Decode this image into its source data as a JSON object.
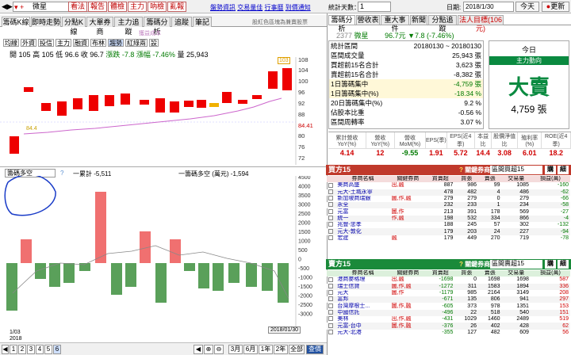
{
  "topbar": {
    "stock": "微星",
    "buttons": [
      "看法",
      "報告",
      "體檢",
      "主力",
      "吶檢",
      "亂報"
    ],
    "links": [
      "盤勢資訊",
      "交易量佳",
      "行事曆",
      "到價通知"
    ],
    "stats_label": "統計天數：",
    "stats_value": "1",
    "date_label": "日期:",
    "date_value": "2018/1/30",
    "today_btn": "今天",
    "update_btn": "更新"
  },
  "tabs": [
    "籌碼K線",
    "即時走勢",
    "分點K線",
    "大單券商",
    "主力追蹤",
    "籌碼分析",
    "追蹤",
    "筆記"
  ],
  "tabs_right_info": "股紅色區塊為兼賣股票",
  "chart_buttons": [
    "均線",
    "外資",
    "投信",
    "主力",
    "融資",
    "布林",
    "趨勢",
    "紅綠兩",
    "設"
  ],
  "ohlc": {
    "open_l": "開",
    "open": "105",
    "high_l": "高",
    "high": "105",
    "low_l": "低",
    "low": "96.6",
    "close_l": "收",
    "close": "96.7",
    "chg_l": "漲跌",
    "chg": "-7.8",
    "pct_l": "漲幅",
    "pct": "-7.46%",
    "vol_l": "量",
    "vol": "25,943"
  },
  "legend_top": "獲益成本",
  "price_axis": [
    "108",
    "104",
    "100",
    "96",
    "92",
    "88",
    "84.41",
    "80",
    "76",
    "72"
  ],
  "ma_value": "84.4",
  "price_tag": "103",
  "lower": {
    "select": "籌碼多空",
    "label1": "一累計",
    "val1": "-5,511",
    "label2": "一籌碼多空 (萬元)",
    "val2": "-1,594"
  },
  "lower_axis": [
    "4500",
    "4000",
    "3500",
    "3000",
    "2500",
    "2000",
    "1500",
    "1000",
    "500",
    "0",
    "-500",
    "-1000",
    "-1500",
    "-2000",
    "-2500",
    "-3000"
  ],
  "date_tag": "2018/01/30",
  "x_start": "1/03",
  "x_year": "2018",
  "bottom_btns": [
    "1",
    "2",
    "3",
    "4",
    "5",
    "6"
  ],
  "period_btns": [
    "3月",
    "6月",
    "1年",
    "2年",
    "全部",
    "查價"
  ],
  "right_tabs": [
    "籌碼分析",
    "營收表",
    "重大事件",
    "新聞",
    "分點追蹤",
    "法人目標(106元)"
  ],
  "quote": {
    "code": "2377",
    "name": "微星",
    "price": "96.7元",
    "chg": "▼7.8 (-7.46%)"
  },
  "stats": [
    [
      "統計區間",
      "20180130 ~ 20180130"
    ],
    [
      "區間成交量",
      "25,943 張"
    ],
    [
      "買超前15名合計",
      "3,623 張"
    ],
    [
      "賣超前15名合計",
      "-8,382 張"
    ],
    [
      "1日籌碼集中",
      "-4,759 張"
    ],
    [
      "1日籌碼集中(%)",
      "-18.34 %"
    ],
    [
      "20日籌碼集中(%)",
      "9.2 %"
    ],
    [
      "佔股本比重",
      "-0.56 %"
    ],
    [
      "區間周轉率",
      "3.07 %"
    ]
  ],
  "today_box": {
    "t1": "今日",
    "t2": "主力動向",
    "big": "大賣",
    "amount": "4,759 張"
  },
  "finance": {
    "headers": [
      "累計營收YoY(%)",
      "營收YoY(%)",
      "營收MoM(%)",
      "EPS(季)",
      "EPS(近4季)",
      "本益比",
      "股價淨值比",
      "殖利率(%)",
      "ROE(近4季)"
    ],
    "values": [
      "4.14",
      "12",
      "-9.55",
      "1.91",
      "5.72",
      "14.4",
      "3.08",
      "6.01",
      "18.2"
    ]
  },
  "buy": {
    "title": "買方15",
    "sel_label": "關鍵券商:",
    "sel": "區間買超15",
    "btn1": "購",
    "btn2": "細",
    "cols": [
      "券商名稱",
      "關鍵券商",
      "買賣超",
      "買張",
      "賣張",
      "交易量",
      "損益(萬)"
    ],
    "rows": [
      [
        "美商高盛",
        "出,融",
        "887",
        "986",
        "99",
        "1085",
        "-160"
      ],
      [
        "元大-土城永寧",
        "",
        "478",
        "482",
        "4",
        "486",
        "-62"
      ],
      [
        "新加坡商瑞銀",
        "圖,作,融",
        "279",
        "279",
        "0",
        "279",
        "-66"
      ],
      [
        "永全",
        "",
        "232",
        "233",
        "1",
        "234",
        "-58"
      ],
      [
        "元富",
        "圖,作",
        "213",
        "391",
        "178",
        "569",
        "-27"
      ],
      [
        "統一",
        "作,融",
        "198",
        "532",
        "334",
        "866",
        "-4"
      ],
      [
        "兆豐-忠孝",
        "",
        "188",
        "245",
        "57",
        "302",
        "-132"
      ],
      [
        "元大-敦化",
        "",
        "179",
        "203",
        "24",
        "227",
        "-94"
      ],
      [
        "宏建",
        "融",
        "179",
        "449",
        "270",
        "719",
        "-78"
      ]
    ]
  },
  "sell": {
    "title": "賣方15",
    "sel_label": "關鍵券商:",
    "sel": "區間賣超15",
    "btn1": "購",
    "btn2": "細",
    "cols": [
      "券商名稱",
      "關鍵券商",
      "買賣超",
      "買張",
      "賣張",
      "交易量",
      "損益(萬)"
    ],
    "rows": [
      [
        "港商麥格理",
        "出,融",
        "-1698",
        "0",
        "1698",
        "1698",
        "587"
      ],
      [
        "瑞士信貸",
        "圖,作,融",
        "-1272",
        "311",
        "1583",
        "1894",
        "336"
      ],
      [
        "元大",
        "圖,作",
        "-1179",
        "985",
        "2164",
        "3149",
        "208"
      ],
      [
        "富邦",
        "",
        "-671",
        "135",
        "806",
        "941",
        "297"
      ],
      [
        "台灣摩根士...",
        "圖,作,融",
        "-605",
        "373",
        "978",
        "1351",
        "153"
      ],
      [
        "中國信託",
        "",
        "-496",
        "22",
        "518",
        "540",
        "151"
      ],
      [
        "美林",
        "出,作,融",
        "-431",
        "1029",
        "1460",
        "2489",
        "519"
      ],
      [
        "元富-台中",
        "圖,作,融",
        "-376",
        "26",
        "402",
        "428",
        "62"
      ],
      [
        "元大-北港",
        "",
        "-355",
        "127",
        "482",
        "609",
        "56"
      ]
    ]
  }
}
